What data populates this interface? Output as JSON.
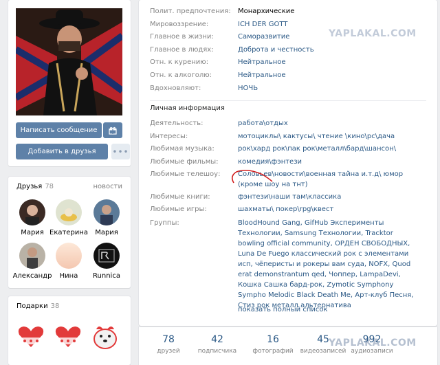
{
  "profile": {
    "send_message": "Написать сообщение",
    "add_friend": "Добавить в друзья",
    "gift_icon": "gift-icon",
    "more_icon": "more-dots-icon"
  },
  "friends": {
    "title": "Друзья",
    "count": "78",
    "link": "новости",
    "items": [
      {
        "name": "Мария"
      },
      {
        "name": "Екатерина"
      },
      {
        "name": "Мария"
      },
      {
        "name": "Александр"
      },
      {
        "name": "Нина"
      },
      {
        "name": "Runnica"
      }
    ]
  },
  "gifts": {
    "title": "Подарки",
    "count": "38"
  },
  "info": {
    "top_rows": [
      {
        "label": "Полит. предпочтения:",
        "value": "Монархические",
        "link": false
      },
      {
        "label": "Мировоззрение:",
        "value": "ICH DER GOTT",
        "link": true
      },
      {
        "label": "Главное в жизни:",
        "value": "Саморазвитие",
        "link": true
      },
      {
        "label": "Главное в людях:",
        "value": "Доброта и честность",
        "link": true
      },
      {
        "label": "Отн. к курению:",
        "value": "Нейтральное",
        "link": true
      },
      {
        "label": "Отн. к алкоголю:",
        "value": "Нейтральное",
        "link": true
      },
      {
        "label": "Вдохновляют:",
        "value": "НОЧЬ",
        "link": true
      }
    ],
    "personal_title": "Личная информация",
    "personal_rows": [
      {
        "label": "Деятельность:",
        "value": "работа\\отдых"
      },
      {
        "label": "Интересы:",
        "value": "мотоциклы\\ кактусы\\ чтение \\кино\\рс\\дача"
      },
      {
        "label": "Любимая музыка:",
        "value": "рок\\хард рок\\пак рок\\металл\\бард\\шансон\\"
      },
      {
        "label": "Любимые фильмы:",
        "value": "комедия\\фэнтези"
      }
    ],
    "tv_label": "Любимые телешоу:",
    "tv_value": "Соловьев\\новости\\военная тайна и.т.д\\ юмор (кроме шоу на тнт)",
    "books_label": "Любимые книги:",
    "books_value": "фэнтези\\наши там\\классика",
    "games_label": "Любимые игры:",
    "games_value": "шахматы\\ покер\\rpg\\квест",
    "groups_label": "Группы:",
    "groups_value": "BloodHound Gang, GifHub Эксперименты Технологии, Samsung Технологии, Tracktor bowling official community, ОРДЕН СВОБОДНЫХ, Luna De Fuego классический рок с элементами исп, чёперисты и рокеры вам суда, NOFX, Quod erat demonstrantum qed, Чоппер, LampaDevi, Кошка Сашка бард-рок, Zymotic Symphony Sympho Melodic Black Death Me, Арт-клуб Песня, Стиз рок металл альтернатива",
    "show_full": "показать полный список"
  },
  "counters": [
    {
      "num": "78",
      "cap": "друзей"
    },
    {
      "num": "42",
      "cap": "подписчика"
    },
    {
      "num": "16",
      "cap": "фотографий"
    },
    {
      "num": "45",
      "cap": "видеозаписей"
    },
    {
      "num": "992",
      "cap": "аудиозаписи"
    }
  ],
  "watermark": "YAPLAKAL.COM"
}
